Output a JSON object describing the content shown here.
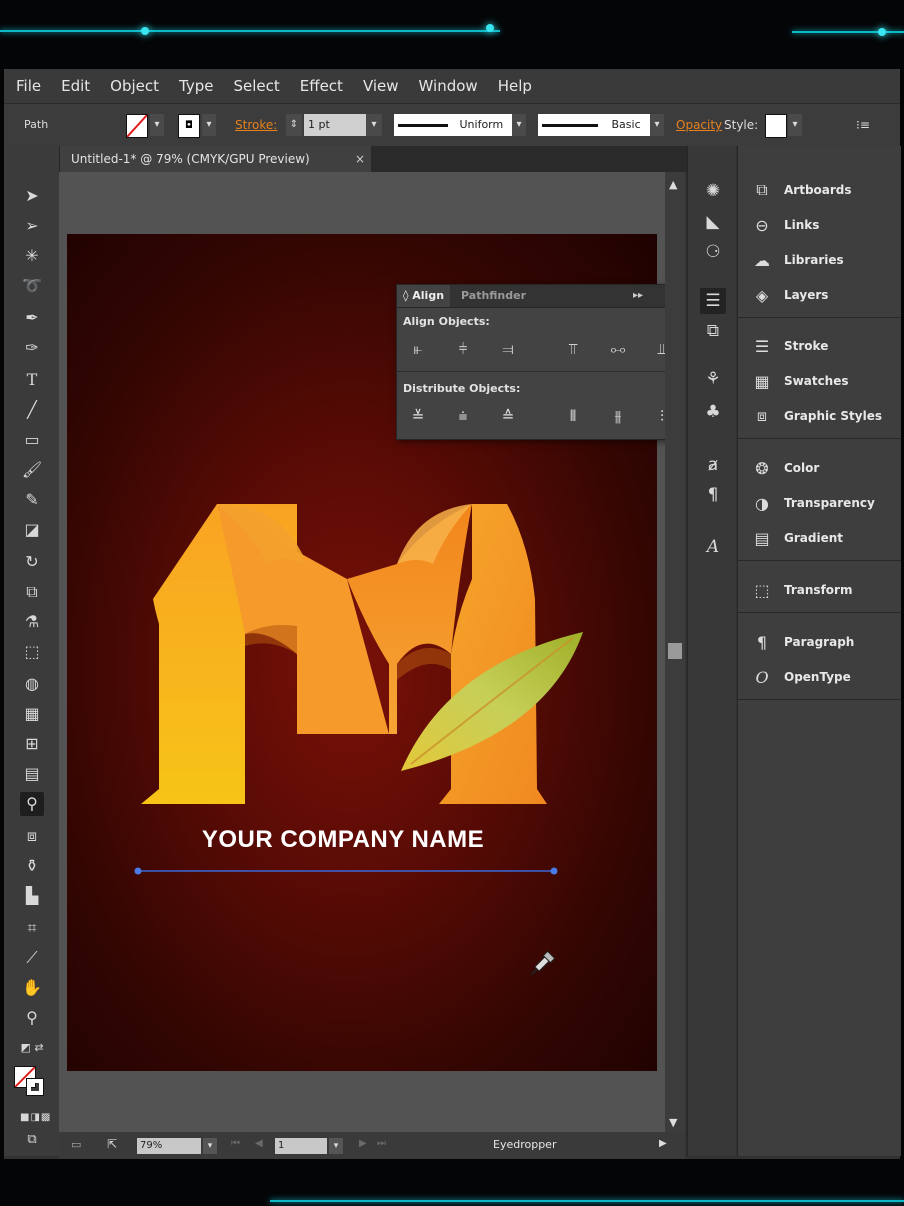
{
  "menu": [
    "File",
    "Edit",
    "Object",
    "Type",
    "Select",
    "Effect",
    "View",
    "Window",
    "Help"
  ],
  "control": {
    "selection_type": "Path",
    "stroke_label": "Stroke:",
    "stroke_weight": "1 pt",
    "profile": "Uniform",
    "brush": "Basic",
    "opacity_label": "Opacity",
    "style_label": "Style:"
  },
  "document": {
    "tab_title": "Untitled-1* @ 79% (CMYK/GPU Preview)",
    "close": "×"
  },
  "align_panel": {
    "tab_align": "Align",
    "tab_pathfinder": "Pathfinder",
    "align_objects": "Align Objects:",
    "distribute_objects": "Distribute Objects:"
  },
  "panels": [
    "Artboards",
    "Links",
    "Libraries",
    "Layers",
    "Stroke",
    "Swatches",
    "Graphic Styles",
    "Color",
    "Transparency",
    "Gradient",
    "Transform",
    "Paragraph",
    "OpenType"
  ],
  "artwork": {
    "company_name": "YOUR COMPANY NAME"
  },
  "status": {
    "zoom": "79%",
    "artboard_number": "1",
    "current_tool": "Eyedropper"
  },
  "colors": {
    "logo_orange": "#f08c1c",
    "logo_yellow": "#f7b318",
    "leaf_green": "#b8c63a",
    "artboard_red": "#5a0b05",
    "accent_cyan": "#11d7e8"
  }
}
